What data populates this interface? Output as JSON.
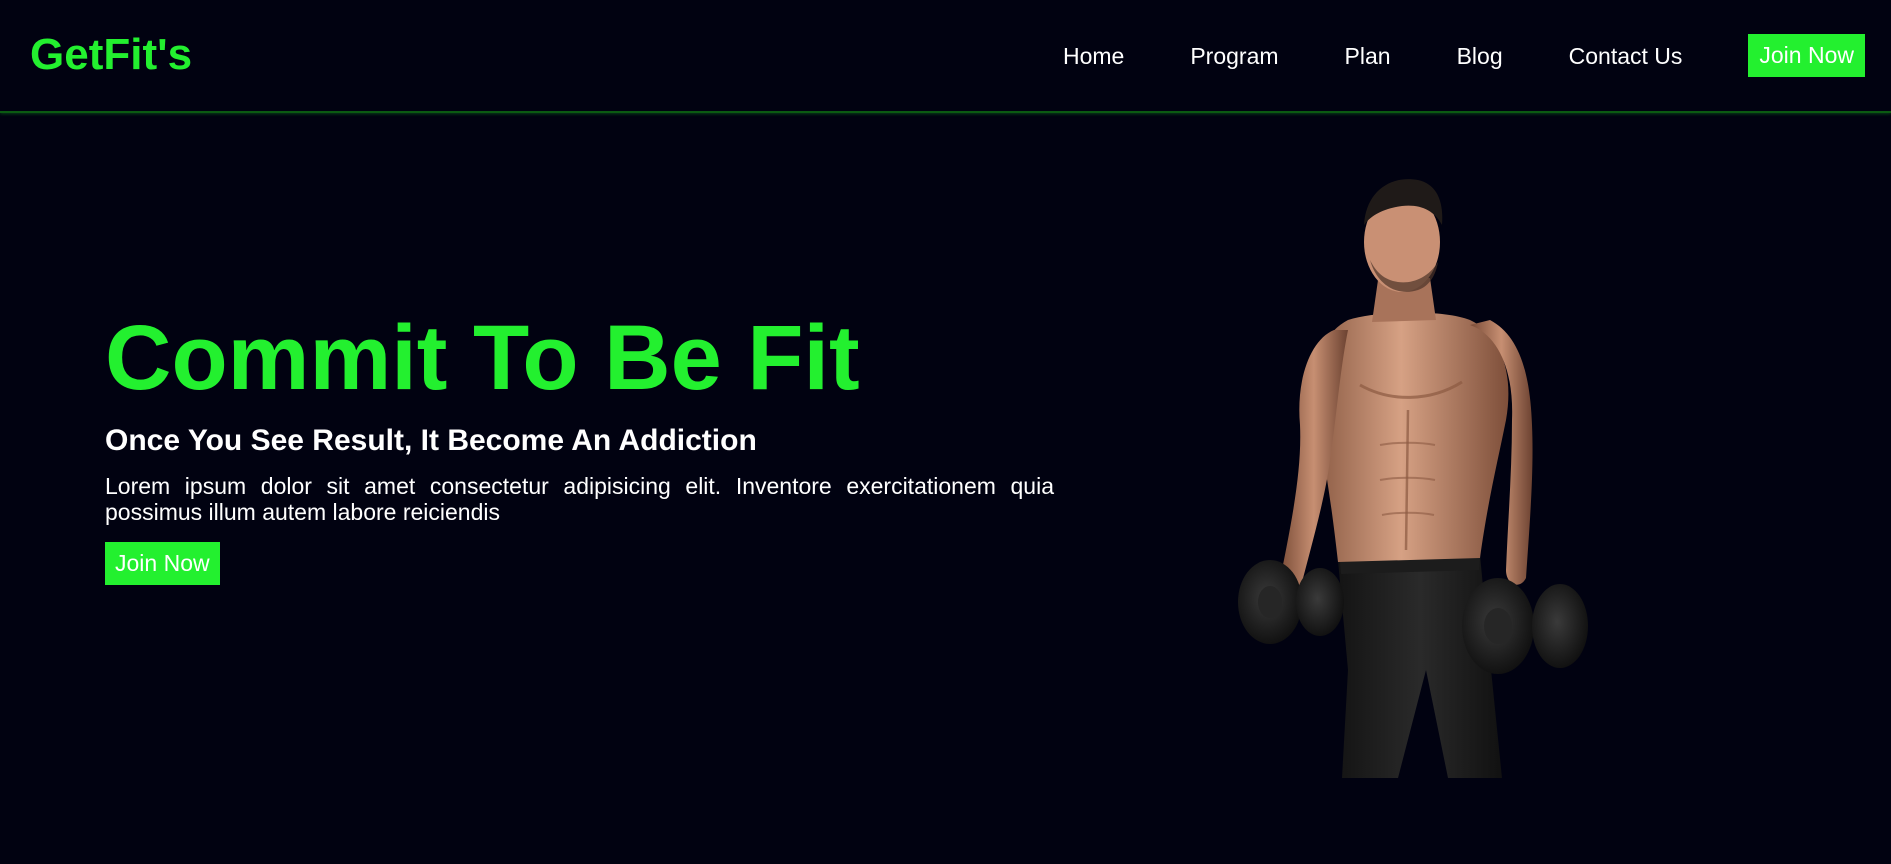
{
  "brand": {
    "logo": "GetFit's"
  },
  "nav": {
    "links": [
      "Home",
      "Program",
      "Plan",
      "Blog",
      "Contact Us"
    ],
    "cta": "Join Now"
  },
  "hero": {
    "title": "Commit To Be Fit",
    "subtitle": "Once You See Result, It Become An Addiction",
    "body": "Lorem ipsum dolor sit amet consectetur adipisicing elit. Inventore exercitationem quia possimus illum autem labore reiciendis",
    "cta": "Join Now",
    "image_subject": "shirtless man holding dumbbells"
  },
  "colors": {
    "background": "#010211",
    "accent": "#23f02f",
    "text": "#ffffff"
  }
}
